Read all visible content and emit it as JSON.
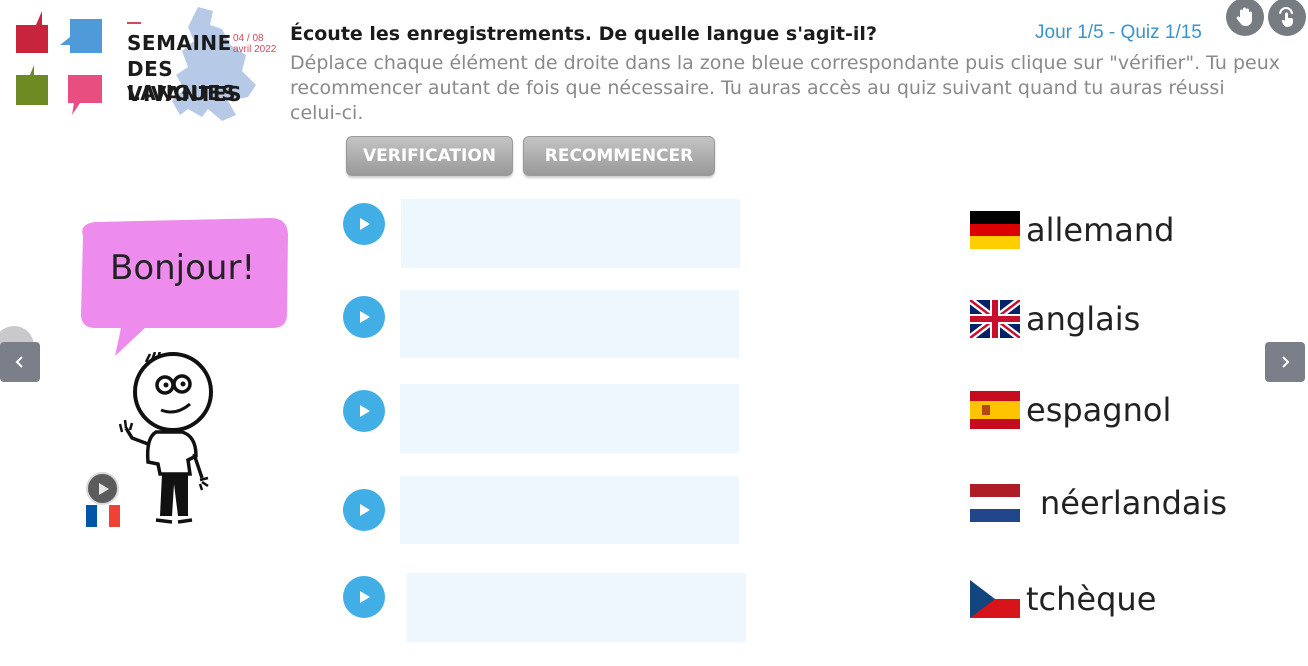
{
  "logo": {
    "line1": "SEMAINE",
    "line2": "DES LANGUES",
    "line3": "VIVANTES",
    "date_line1": "04 / 08",
    "date_line2": "avril 2022"
  },
  "header": {
    "title": "Écoute les enregistrements. De quelle langue s'agit-il?",
    "instructions": "Déplace chaque élément de droite dans la zone bleue correspondante puis clique sur \"vérifier\". Tu peux recommencer autant de fois que nécessaire. Tu auras accès au quiz suivant quand tu auras réussi celui-ci.",
    "progress": "Jour 1/5 - Quiz 1/15"
  },
  "toolbar": {
    "verify_label": "VERIFICATION",
    "restart_label": "RECOMMENCER"
  },
  "scene": {
    "bubble_text": "Bonjour!"
  },
  "answers": [
    {
      "label": "allemand",
      "flag": "germany-flag"
    },
    {
      "label": "anglais",
      "flag": "uk-flag"
    },
    {
      "label": "espagnol",
      "flag": "spain-flag"
    },
    {
      "label": "néerlandais",
      "flag": "netherlands-flag"
    },
    {
      "label": "tchèque",
      "flag": "czech-flag"
    }
  ],
  "colors": {
    "play": "#41aee6",
    "drop_zone": "#eef6fe",
    "progress_text": "#3b93c9",
    "bubble": "#ee8ced",
    "nav": "#7b7f89"
  }
}
